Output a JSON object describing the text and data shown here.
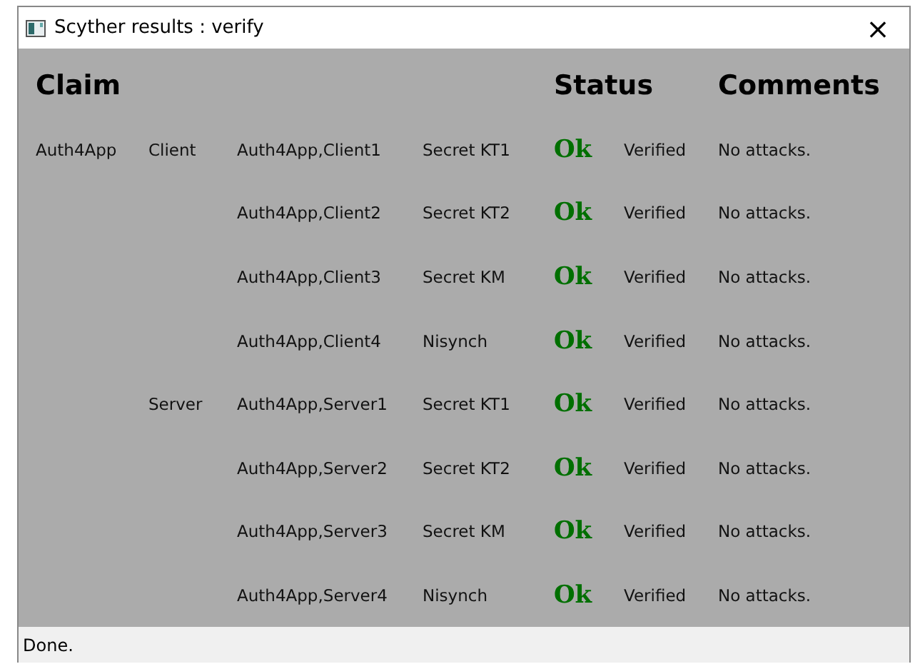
{
  "window": {
    "title": "Scyther results : verify",
    "close": "×"
  },
  "headers": {
    "claim": "Claim",
    "status": "Status",
    "comments": "Comments"
  },
  "rows": [
    {
      "protocol": "Auth4App",
      "role": "Client",
      "claim": "Auth4App,Client1",
      "type": "Secret KT1",
      "status": "Ok",
      "result": "Verified",
      "comment": "No attacks."
    },
    {
      "claim": "Auth4App,Client2",
      "type": "Secret KT2",
      "status": "Ok",
      "result": "Verified",
      "comment": "No attacks."
    },
    {
      "claim": "Auth4App,Client3",
      "type": "Secret KM",
      "status": "Ok",
      "result": "Verified",
      "comment": "No attacks."
    },
    {
      "claim": "Auth4App,Client4",
      "type": "Nisynch",
      "status": "Ok",
      "result": "Verified",
      "comment": "No attacks."
    },
    {
      "role": "Server",
      "claim": "Auth4App,Server1",
      "type": "Secret KT1",
      "status": "Ok",
      "result": "Verified",
      "comment": "No attacks."
    },
    {
      "claim": "Auth4App,Server2",
      "type": "Secret KT2",
      "status": "Ok",
      "result": "Verified",
      "comment": "No attacks."
    },
    {
      "claim": "Auth4App,Server3",
      "type": "Secret KM",
      "status": "Ok",
      "result": "Verified",
      "comment": "No attacks."
    },
    {
      "claim": "Auth4App,Server4",
      "type": "Nisynch",
      "status": "Ok",
      "result": "Verified",
      "comment": "No attacks."
    }
  ],
  "status_bar": "Done."
}
